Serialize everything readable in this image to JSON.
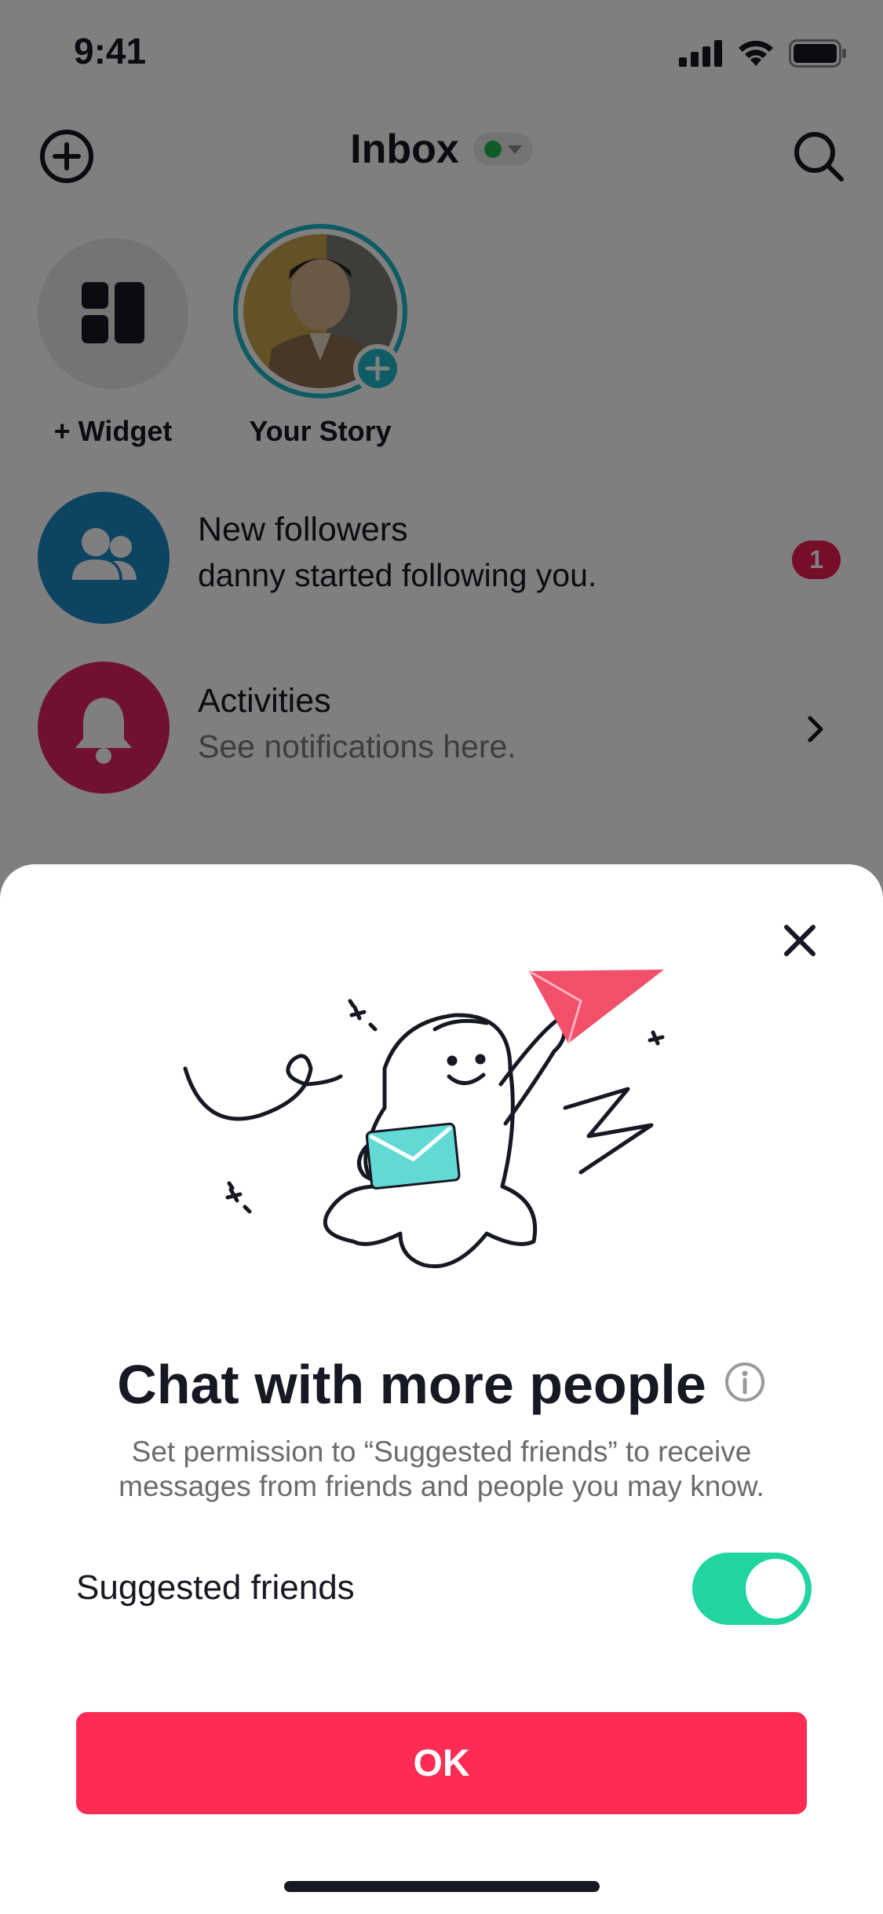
{
  "status_bar": {
    "time": "9:41"
  },
  "header": {
    "title": "Inbox"
  },
  "stories": [
    {
      "label": "+ Widget"
    },
    {
      "label": "Your Story"
    }
  ],
  "rows": [
    {
      "title": "New followers",
      "subtitle": "danny started following you.",
      "badge": "1"
    },
    {
      "title": "Activities",
      "subtitle": "See notifications here."
    }
  ],
  "sheet": {
    "title": "Chat with more people",
    "description": "Set permission to “Suggested friends” to receive messages from friends and people you may know.",
    "toggle_label": "Suggested friends",
    "toggle_on": true,
    "ok_label": "OK"
  },
  "colors": {
    "accent": "#fe2c55",
    "toggle_on": "#20d5a0",
    "followers_icon_bg": "#1a89c4",
    "activities_icon_bg": "#e0245e",
    "online": "#1db954"
  }
}
